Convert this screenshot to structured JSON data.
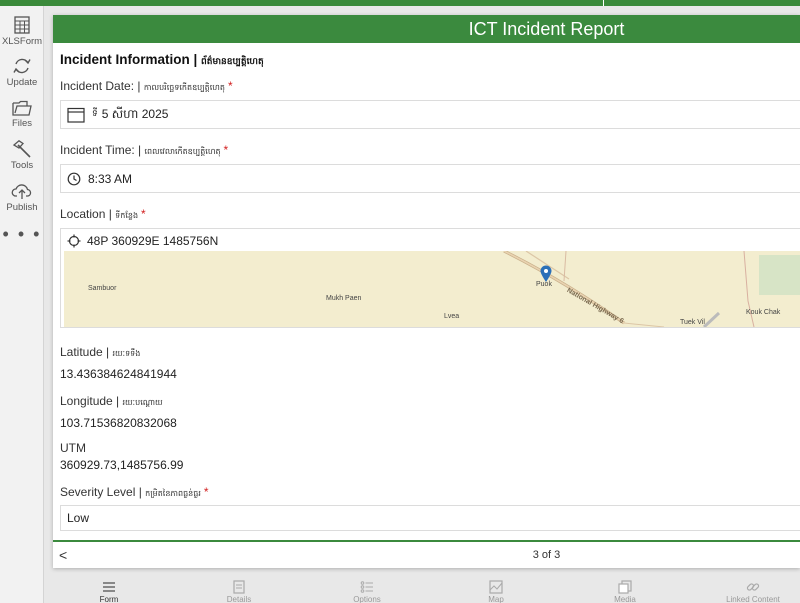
{
  "sidebar": {
    "items": [
      {
        "label": "XLSForm",
        "icon": "spreadsheet-icon"
      },
      {
        "label": "Update",
        "icon": "refresh-icon"
      },
      {
        "label": "Files",
        "icon": "folder-icon"
      },
      {
        "label": "Tools",
        "icon": "hammer-icon"
      },
      {
        "label": "Publish",
        "icon": "cloud-upload-icon"
      }
    ],
    "more": "• • •"
  },
  "form": {
    "title": "ICT Incident Report",
    "section_title": "Incident Information |",
    "section_title_kh": "ព័ត៌មានឧប្បត្តិហេតុ",
    "incident_date": {
      "label": "Incident Date: |",
      "label_kh": "កាលបរិច្ឆេទកើតឧប្បត្តិហេតុ",
      "required": "*",
      "value_kh": "ទី",
      "value": "5 សីហា 2025"
    },
    "incident_time": {
      "label": "Incident Time: |",
      "label_kh": "ពេលវេលាកើតឧប្បត្តិហេតុ",
      "required": "*",
      "value": "8:33 AM"
    },
    "location": {
      "label": "Location |",
      "label_kh": "ទីកន្លែង",
      "required": "*",
      "value": "48P 360929E 1485756N",
      "map_labels": {
        "sambuor": "Sambuor",
        "mukh_paen": "Mukh Paen",
        "lvea": "Lvea",
        "puok": "Puok",
        "highway": "National Highway 6",
        "tuek_vil": "Tuek Vil",
        "kouk_chak": "Kouk Chak"
      }
    },
    "latitude": {
      "label": "Latitude |",
      "label_kh": "រយៈទទឹង",
      "value": "13.436384624841944"
    },
    "longitude": {
      "label": "Longitude |",
      "label_kh": "រយៈបណ្ដោយ",
      "value": "103.71536820832068"
    },
    "utm": {
      "label": "UTM",
      "value": "360929.73,1485756.99"
    },
    "severity": {
      "label": "Severity Level |",
      "label_kh": "កម្រិតនៃភាពធ្ងន់ធ្ងរ",
      "required": "*",
      "value": "Low"
    },
    "back": "<",
    "pager": "3 of 3"
  },
  "tabs": [
    {
      "label": "Form",
      "icon": "form-icon",
      "active": true
    },
    {
      "label": "Details",
      "icon": "details-icon"
    },
    {
      "label": "Options",
      "icon": "options-icon"
    },
    {
      "label": "Map",
      "icon": "map-icon"
    },
    {
      "label": "Media",
      "icon": "media-icon"
    },
    {
      "label": "Linked Content",
      "icon": "link-icon"
    }
  ],
  "colors": {
    "brand_green": "#3b8a3e",
    "required_red": "#d21f1f",
    "pin_blue": "#2b6fb8"
  }
}
